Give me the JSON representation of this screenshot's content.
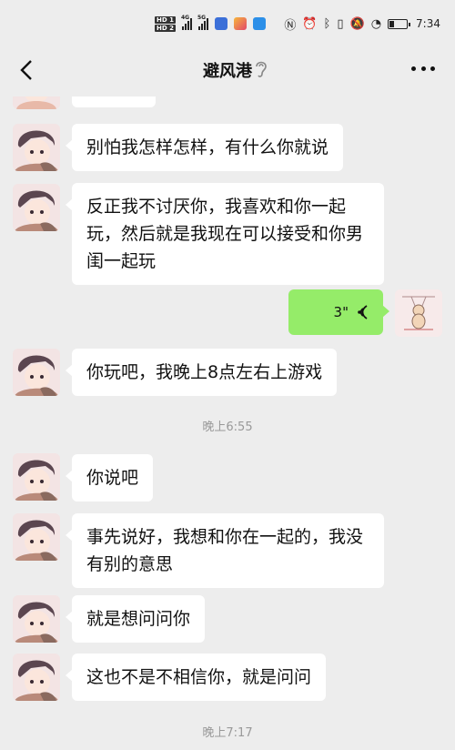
{
  "status_bar": {
    "hd1": "HD 1",
    "hd2": "HD 2",
    "net1": "4G",
    "net2": "5G",
    "time": "7:34"
  },
  "nav": {
    "title": "避风港"
  },
  "messages": {
    "m1": "别怕我怎样怎样，有什么你就说",
    "m2": "反正我不讨厌你，我喜欢和你一起玩，然后就是我现在可以接受和你男闺一起玩",
    "m3_duration": "3\"",
    "m4": "你玩吧，我晚上8点左右上游戏",
    "time1": "晚上6:55",
    "m5": "你说吧",
    "m6": "事先说好，我想和你在一起的，我没有别的意思",
    "m7": "就是想问问你",
    "m8": "这也不是不相信你，就是问问",
    "time2": "晚上7:17"
  },
  "colors": {
    "background": "#ededed",
    "bubble_self": "#95ec69",
    "bubble_other": "#ffffff"
  },
  "icons": [
    "back-arrow-icon",
    "ear-icon",
    "more-icon",
    "voice-wave-icon",
    "battery-icon",
    "alarm-icon",
    "bluetooth-icon",
    "nfc-icon"
  ]
}
